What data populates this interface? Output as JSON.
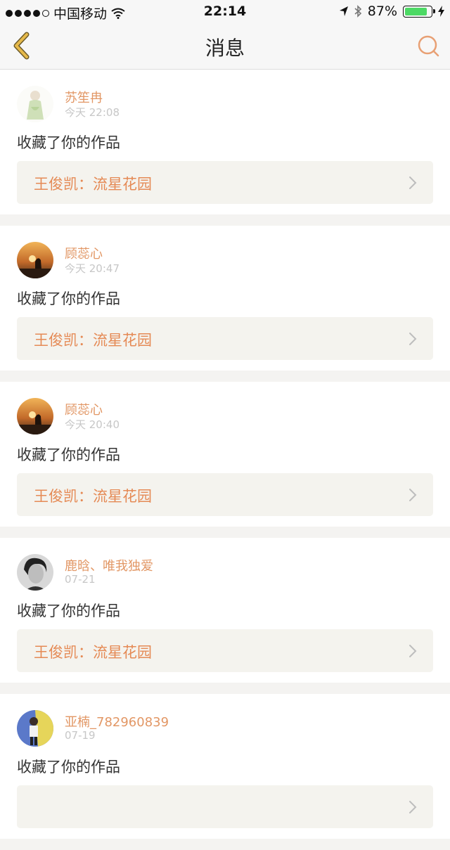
{
  "status_bar": {
    "carrier": "中国移动",
    "time": "22:14",
    "battery": "87%",
    "battery_level": 0.87
  },
  "nav": {
    "title": "消息",
    "back_icon": "chevron-left-icon",
    "search_icon": "search-icon"
  },
  "colors": {
    "accent": "#e58a55",
    "name": "#e29765",
    "back": "#e6b94a"
  },
  "messages": [
    {
      "user": "苏笙冉",
      "time": "今天 22:08",
      "action": "收藏了你的作品",
      "work": "王俊凯：流星花园",
      "avatar": "avatar-doll"
    },
    {
      "user": "顾蕊心",
      "time": "今天 20:47",
      "action": "收藏了你的作品",
      "work": "王俊凯：流星花园",
      "avatar": "avatar-sunset"
    },
    {
      "user": "顾蕊心",
      "time": "今天 20:40",
      "action": "收藏了你的作品",
      "work": "王俊凯：流星花园",
      "avatar": "avatar-sunset"
    },
    {
      "user": "鹿晗、唯我独爱",
      "time": "07-21",
      "action": "收藏了你的作品",
      "work": "王俊凯：流星花园",
      "avatar": "avatar-portrait"
    },
    {
      "user": "亚楠_782960839",
      "time": "07-19",
      "action": "收藏了你的作品",
      "work": "",
      "avatar": "avatar-blue"
    }
  ]
}
